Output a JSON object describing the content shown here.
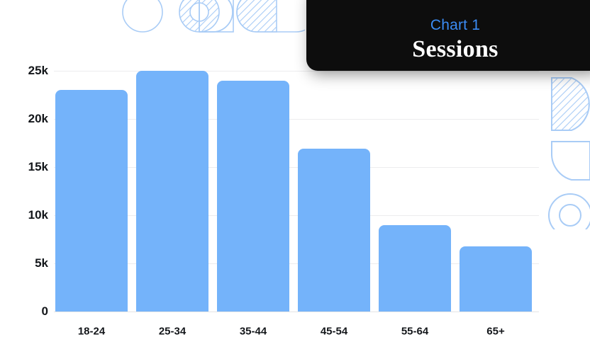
{
  "card": {
    "eyebrow": "Chart 1",
    "title": "Sessions",
    "background_color": "#0d0d0d",
    "eyebrow_color": "#3b8cf5",
    "title_color": "#ffffff"
  },
  "chart_data": {
    "type": "bar",
    "title": "Sessions",
    "subtitle": "Chart 1",
    "xlabel": "",
    "ylabel": "",
    "categories": [
      "18-24",
      "25-34",
      "35-44",
      "45-54",
      "55-64",
      "65+"
    ],
    "values": [
      23000,
      25000,
      24000,
      16900,
      9000,
      6800
    ],
    "ytick_labels": [
      "25k",
      "20k",
      "15k",
      "10k",
      "5k",
      "0"
    ],
    "ytick_values": [
      25000,
      20000,
      15000,
      10000,
      5000,
      0
    ],
    "ylim": [
      0,
      25000
    ],
    "grid": true,
    "legend": "none",
    "bar_color": "#74b3fa",
    "gridline_color": "#ececee",
    "tick_label_color": "#13161a"
  },
  "decorations": {
    "top": [
      {
        "name": "circle-outline",
        "shape": "circle"
      },
      {
        "name": "hatched-donut",
        "shape": "donut-hatched"
      },
      {
        "name": "rounded-rect-outline",
        "shape": "rounded-rect"
      },
      {
        "name": "hatched-half-circle",
        "shape": "half-circle-hatched"
      },
      {
        "name": "rounded-capsule-outline",
        "shape": "capsule"
      }
    ],
    "right": [
      {
        "name": "hatched-rounded-shape",
        "shape": "rounded-hatched"
      },
      {
        "name": "rounded-corner-outline",
        "shape": "rounded-corner"
      },
      {
        "name": "concentric-circle-outline",
        "shape": "donut"
      }
    ],
    "outline_color": "#a9ccf6"
  }
}
